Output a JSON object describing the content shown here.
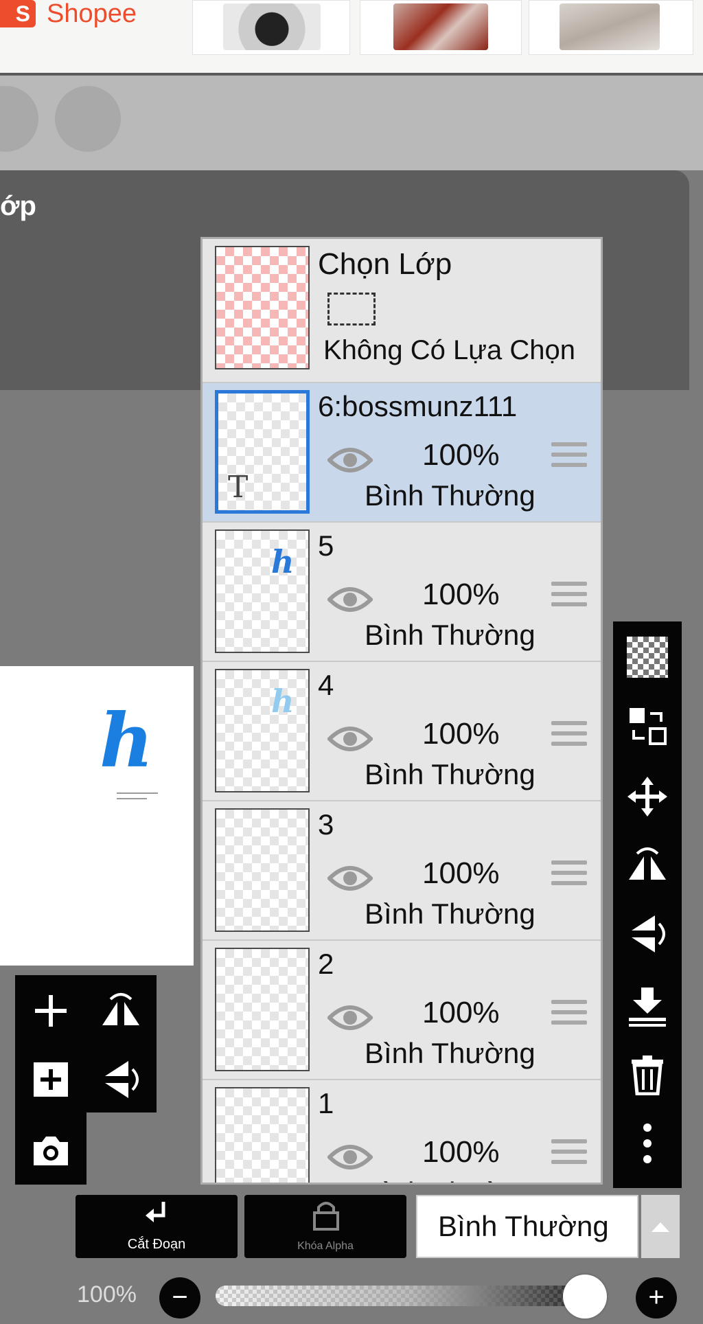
{
  "ad": {
    "brand": "Shopee",
    "brand_initial": "S"
  },
  "panel": {
    "title_partial": "ớp"
  },
  "canvas": {
    "mark": "h"
  },
  "selection_layer": {
    "title": "Chọn Lớp",
    "status": "Không Có Lựa Chọn"
  },
  "layers": [
    {
      "name": "6:bossmunz111",
      "opacity": "100%",
      "blend": "Bình Thường",
      "selected": true,
      "thumb": "text"
    },
    {
      "name": "5",
      "opacity": "100%",
      "blend": "Bình Thường",
      "selected": false,
      "thumb": "h-dark"
    },
    {
      "name": "4",
      "opacity": "100%",
      "blend": "Bình Thường",
      "selected": false,
      "thumb": "h-light"
    },
    {
      "name": "3",
      "opacity": "100%",
      "blend": "Bình Thường",
      "selected": false,
      "thumb": "empty"
    },
    {
      "name": "2",
      "opacity": "100%",
      "blend": "Bình Thường",
      "selected": false,
      "thumb": "empty"
    },
    {
      "name": "1",
      "opacity": "100%",
      "blend": "Bình Thường",
      "selected": false,
      "thumb": "empty"
    }
  ],
  "thumb_glyph": {
    "text_layer": "T",
    "h": "h"
  },
  "right_toolbar": [
    "transparency-icon",
    "swap-layers-icon",
    "move-icon",
    "flip-horizontal-icon",
    "flip-vertical-icon",
    "merge-down-icon",
    "trash-icon",
    "more-icon"
  ],
  "left_toolbar": [
    "add-layer-icon",
    "flip-horizontal-icon",
    "add-image-layer-icon",
    "flip-vertical-icon",
    "camera-icon"
  ],
  "bottom": {
    "clip_label": "Cắt Đoạn",
    "alpha_lock_label": "Khóa Alpha",
    "blend_mode": "Bình Thường",
    "zoom": "100%",
    "minus": "−",
    "plus": "+",
    "opacity_slider_value": 1.0
  },
  "colors": {
    "accent": "#2a78d8",
    "shopee": "#ee4d2d",
    "selected_row": "#c9d7ea",
    "toolbar": "#050505"
  }
}
